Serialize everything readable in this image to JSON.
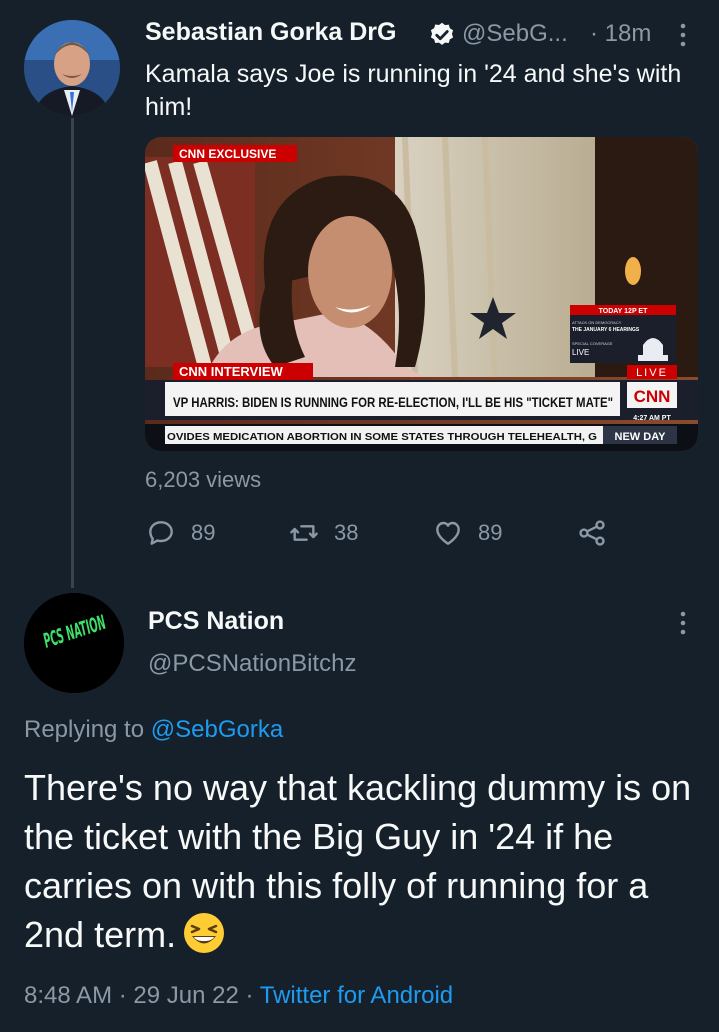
{
  "tweet": {
    "author_name": "Sebastian Gorka DrG",
    "handle": "@SebG...",
    "time_sep": "·",
    "time": "18m",
    "text": "Kamala says Joe is running in '24 and she's with him!",
    "views": "6,203 views",
    "replies": "89",
    "retweets": "38",
    "likes": "89",
    "media": {
      "bug": "CNN EXCLUSIVE",
      "today_label": "TODAY 12P ET",
      "hearing_small": "ATTACK ON DEMOCRACY",
      "hearing_title": "THE JANUARY 6 HEARINGS",
      "coverage": "SPECIAL COVERAGE",
      "live_small": "LIVE",
      "interview_tag": "CNN INTERVIEW",
      "live_tag": "LIVE",
      "headline": "VP HARRIS: BIDEN IS RUNNING FOR RE-ELECTION, I'LL BE HIS \"TICKET MATE\"",
      "logo": "CNN",
      "clock": "4:27 AM PT",
      "ticker": "OVIDES MEDICATION ABORTION IN SOME STATES THROUGH TELEHEALTH, G",
      "show": "NEW DAY"
    }
  },
  "reply": {
    "author_name": "PCS Nation",
    "handle": "@PCSNationBitchz",
    "avatar_text": "PCS NATION",
    "replying_prefix": "Replying to",
    "replying_to": "@SebGorka",
    "text": "There's no way that kackling dummy is on the ticket with the Big Guy in '24 if he carries on with this folly of running for a 2nd term.",
    "time": "8:48 AM",
    "sep1": "·",
    "date": "29 Jun 22",
    "sep2": "·",
    "source": "Twitter for Android"
  },
  "colors": {
    "background": "#15202b",
    "primary_text": "#f7f9f9",
    "secondary_text": "#8b98a5",
    "accent": "#1d9bf0",
    "verified_badge": "#f7f9f9",
    "cnn_red": "#cc0000"
  }
}
